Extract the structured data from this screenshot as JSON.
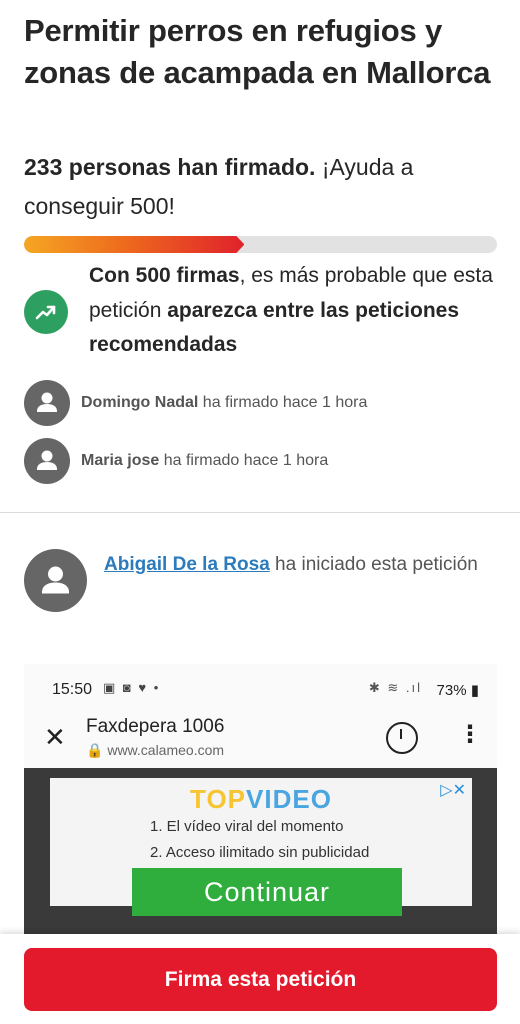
{
  "petition": {
    "title": "Permitir perros en refugios y zonas de acampada en Mallorca",
    "signed_count_text": "233 personas han firmado.",
    "help_text": " ¡Ayuda a conseguir 500!",
    "progress_fraction": 0.466,
    "milestone_bold1": "Con 500 firmas",
    "milestone_text1": ", es más probable que esta petición ",
    "milestone_bold2": "aparezca entre las peticiones recomendadas"
  },
  "signers": [
    {
      "name": "Domingo Nadal",
      "action": " ha firmado hace 1 hora"
    },
    {
      "name": "Maria jose",
      "action": " ha firmado hace 1 hora"
    }
  ],
  "starter": {
    "name": "Abigail De la Rosa",
    "action": " ha iniciado esta petición"
  },
  "embedded_screenshot": {
    "time": "15:50",
    "battery": "73%",
    "page_title": "Faxdepera 1006",
    "url": "www.calameo.com",
    "ad_brand_top": "TOP",
    "ad_brand_video": "VIDEO",
    "ad_line1": "1. El vídeo viral del momento",
    "ad_line2": "2. Acceso ilimitado sin publicidad",
    "ad_cta": "Continuar"
  },
  "footer": {
    "sign_button": "Firma esta petición"
  },
  "colors": {
    "accent_red": "#e3192c",
    "trend_green": "#2d9f60",
    "link_blue": "#2b7bbd"
  }
}
